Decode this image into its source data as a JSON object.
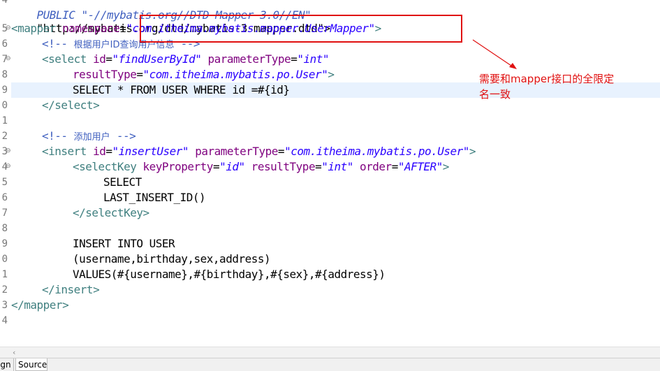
{
  "editor": {
    "line_numbers": [
      "4",
      "5",
      "6",
      "7",
      "8",
      "9",
      "0",
      "1",
      "2",
      "3",
      "4",
      "5",
      "6",
      "7",
      "8",
      "9",
      "0",
      "1",
      "2",
      "3",
      "4"
    ],
    "lines": {
      "l1": "PUBLIC \"-//mybatis.org//DTD Mapper 3.0//EN\"",
      "l2": "\"http://mybatis.org/dtd/mybatis-3-mapper.dtd\">",
      "l3_tag": "<mapper ",
      "l3_attr": "namespace",
      "l3_eq": "=",
      "l3_val": "\"com.itheima.mybatis.mapper.UserMapper\"",
      "l3_close": ">",
      "l4_open": "<!-- ",
      "l4_text": "根据用户ID查询用户信息",
      "l4_close": " -->",
      "l5_tag": "<select ",
      "l5_a1": "id",
      "l5_v1": "\"findUserById\"",
      "l5_a2": " parameterType",
      "l5_v2": "\"int\"",
      "l6_a": "resultType",
      "l6_v": "\"com.itheima.mybatis.po.User\"",
      "l6_close": ">",
      "l7": "SELECT * FROM USER WHERE id =#{id}",
      "l8": "</select>",
      "l10_open": "<!-- ",
      "l10_text": "添加用户",
      "l10_close": " -->",
      "l11_tag": "<insert ",
      "l11_a1": "id",
      "l11_v1": "\"insertUser\"",
      "l11_a2": " parameterType",
      "l11_v2": "\"com.itheima.mybatis.po.User\"",
      "l11_close": ">",
      "l12_tag": "<selectKey ",
      "l12_a1": "keyProperty",
      "l12_v1": "\"id\"",
      "l12_a2": " resultType",
      "l12_v2": "\"int\"",
      "l12_a3": " order",
      "l12_v3": "\"AFTER\"",
      "l12_close": ">",
      "l13": "SELECT",
      "l14": "LAST_INSERT_ID()",
      "l15": "</selectKey>",
      "l17": "INSERT INTO USER",
      "l18": "(username,birthday,sex,address)",
      "l19": "VALUES(#{username},#{birthday},#{sex},#{address})",
      "l20": "</insert>",
      "l21": "</mapper>"
    }
  },
  "annotation": {
    "text": "需要和mapper接口的全限定名一致",
    "color": "#e01010"
  },
  "tabs": {
    "design": "ign",
    "source": "Source"
  },
  "colors": {
    "tag": "#3f7f7f",
    "attribute": "#7f007f",
    "value": "#2a00ff",
    "comment": "#3f5fbf",
    "highlight": "#e8f2fe"
  }
}
